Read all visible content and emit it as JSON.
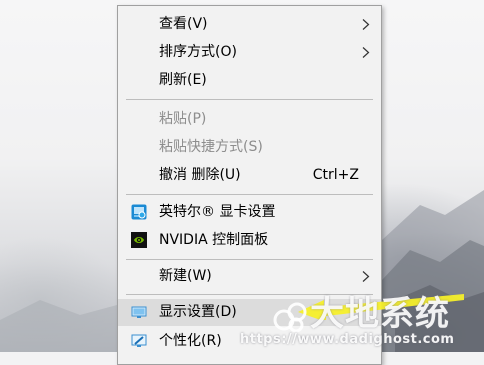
{
  "context_menu": {
    "items": [
      {
        "label": "查看(V)",
        "has_submenu": true
      },
      {
        "label": "排序方式(O)",
        "has_submenu": true
      },
      {
        "label": "刷新(E)"
      },
      {
        "label": "粘贴(P)",
        "disabled": true
      },
      {
        "label": "粘贴快捷方式(S)",
        "disabled": true
      },
      {
        "label": "撤消 删除(U)",
        "shortcut": "Ctrl+Z"
      },
      {
        "label": "英特尔® 显卡设置",
        "icon": "intel-graphics-icon"
      },
      {
        "label": "NVIDIA 控制面板",
        "icon": "nvidia-icon"
      },
      {
        "label": "新建(W)",
        "has_submenu": true
      },
      {
        "label": "显示设置(D)",
        "icon": "display-settings-icon",
        "highlighted": true
      },
      {
        "label": "个性化(R)",
        "icon": "personalize-icon"
      }
    ]
  },
  "watermark": {
    "text": "大地系统",
    "url": "https://www.dadighost.com"
  },
  "colors": {
    "menu_background": "#f2f2f2",
    "menu_border": "#a0a0a0",
    "separator": "#bdbdbd",
    "disabled_text": "#8d8d8d",
    "hover_background": "#dcdcdc",
    "arrow": "#f5ef2a",
    "nvidia_green": "#76b900",
    "intel_blue": "#1a8ad4"
  }
}
